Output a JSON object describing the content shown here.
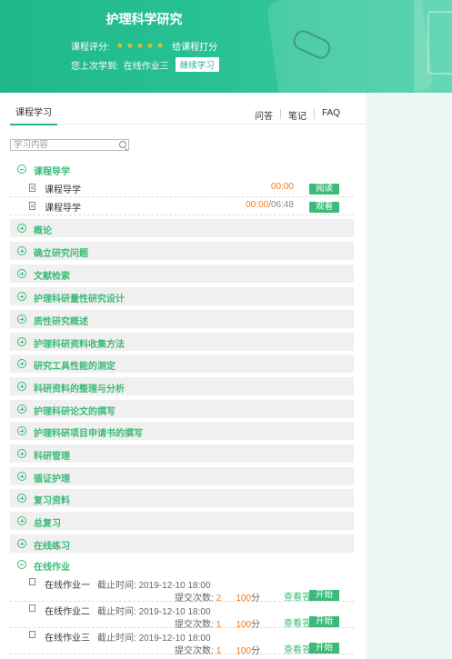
{
  "banner": {
    "course_title": "护理科学研究",
    "rating_label": "课程评分:",
    "stars": "★★★★★",
    "rate_link": "给课程打分",
    "progress_label": "您上次学到:",
    "progress_item": "在线作业三",
    "continue_button": "继续学习"
  },
  "tabs": {
    "active": "课程学习",
    "links": [
      "问答",
      "笔记",
      "FAQ"
    ]
  },
  "search": {
    "placeholder": "学习内容"
  },
  "intro_chapter": {
    "title": "课程导学",
    "lessons": [
      {
        "title": "课程导学",
        "time": "00:00",
        "duration": "",
        "action": "阅读"
      },
      {
        "title": "课程导学",
        "time": "00:00",
        "duration": "/06:48",
        "action": "观看"
      }
    ]
  },
  "chapters": [
    "概论",
    "确立研究问题",
    "文献检索",
    "护理科研量性研究设计",
    "质性研究概述",
    "护理科研资料收集方法",
    "研究工具性能的测定",
    "科研资料的整理与分析",
    "护理科研论文的撰写",
    "护理科研项目申请书的撰写",
    "科研管理",
    "循证护理",
    "复习资料",
    "总复习",
    "在线练习"
  ],
  "homework_chapter": {
    "title": "在线作业",
    "items": [
      {
        "name": "在线作业一",
        "deadline_label": "截止时间:",
        "deadline": "2019-12-10 18:00",
        "submit_label": "提交次数:",
        "count": "2",
        "score": "100",
        "unit": "分",
        "view_label": "查看答",
        "action": "开始"
      },
      {
        "name": "在线作业二",
        "deadline_label": "截止时间:",
        "deadline": "2019-12-10 18:00",
        "submit_label": "提交次数:",
        "count": "1",
        "score": "100",
        "unit": "分",
        "view_label": "查看答",
        "action": "开始"
      },
      {
        "name": "在线作业三",
        "deadline_label": "截止时间:",
        "deadline": "2019-12-10 18:00",
        "submit_label": "提交次数:",
        "count": "1",
        "score": "100",
        "unit": "分",
        "view_label": "查看答",
        "action": "开始"
      }
    ]
  },
  "colors": {
    "accent": "#1fb889",
    "chapter_text": "#3cbb78",
    "highlight": "#f07b1c",
    "star": "#f7c21c"
  }
}
